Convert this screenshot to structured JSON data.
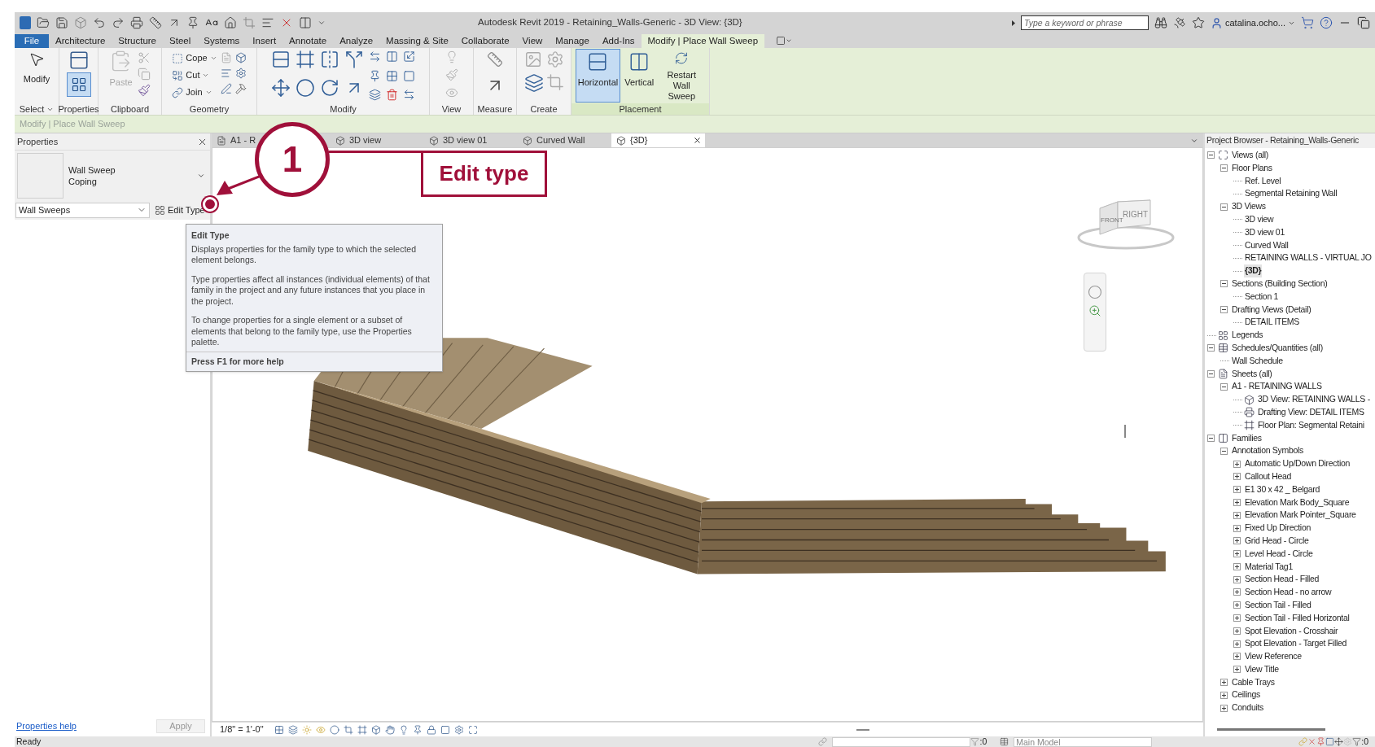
{
  "title_bar": {
    "title": "Autodesk Revit 2019 - Retaining_Walls-Generic - 3D View: {3D}",
    "search": {
      "placeholder": "Type a keyword or phrase"
    },
    "user": "catalina.ocho..."
  },
  "ribbon_tabs": [
    {
      "label": "File",
      "kind": "file",
      "selected": false
    },
    {
      "label": "Architecture",
      "kind": "tab",
      "selected": false
    },
    {
      "label": "Structure",
      "kind": "tab",
      "selected": false
    },
    {
      "label": "Steel",
      "kind": "tab",
      "selected": false
    },
    {
      "label": "Systems",
      "kind": "tab",
      "selected": false
    },
    {
      "label": "Insert",
      "kind": "tab",
      "selected": false
    },
    {
      "label": "Annotate",
      "kind": "tab",
      "selected": false
    },
    {
      "label": "Analyze",
      "kind": "tab",
      "selected": false
    },
    {
      "label": "Massing & Site",
      "kind": "tab",
      "selected": false
    },
    {
      "label": "Collaborate",
      "kind": "tab",
      "selected": false
    },
    {
      "label": "View",
      "kind": "tab",
      "selected": false
    },
    {
      "label": "Manage",
      "kind": "tab",
      "selected": false
    },
    {
      "label": "Add-Ins",
      "kind": "tab",
      "selected": false
    },
    {
      "label": "Modify | Place Wall Sweep",
      "kind": "tab",
      "selected": true
    }
  ],
  "ribbon_panels": [
    {
      "label": "Select",
      "tools": [
        {
          "label": "Modify"
        }
      ]
    },
    {
      "label": "Properties"
    },
    {
      "label": "Clipboard",
      "tools": [
        {
          "label": "Paste",
          "disabled": true
        }
      ]
    },
    {
      "label": "Geometry",
      "tools": [
        {
          "label": "Cope"
        },
        {
          "label": "Cut"
        },
        {
          "label": "Join"
        }
      ]
    },
    {
      "label": "Modify"
    },
    {
      "label": "View"
    },
    {
      "label": "Measure"
    },
    {
      "label": "Create"
    },
    {
      "label": "Placement",
      "tools": [
        {
          "label": "Horizontal",
          "selected": true
        },
        {
          "label": "Vertical",
          "selected": false
        },
        {
          "label": "Restart Wall Sweep",
          "selected": false
        }
      ]
    }
  ],
  "options_bar": {
    "text": "Modify | Place Wall Sweep"
  },
  "properties": {
    "title": "Properties",
    "type_name": "Wall Sweep",
    "type_variant": "Coping",
    "filter": "Wall Sweeps",
    "edit_type": "Edit Type",
    "help_link": "Properties help",
    "apply": "Apply"
  },
  "tooltip": {
    "title": "Edit Type",
    "paragraphs": [
      "Displays properties for the family type to which the selected element belongs.",
      "Type properties affect all instances (individual elements) of that family in the project and any future instances that you place in the project.",
      "To change properties for a single element or a subset of elements that belong to the family type, use the Properties palette."
    ],
    "footer": "Press F1 for more help"
  },
  "annotation": {
    "number": "1",
    "label": "Edit type"
  },
  "view_tabs": [
    {
      "label": "A1 - R",
      "kind": "sheet",
      "selected": false
    },
    {
      "label": "3D view",
      "kind": "view3d",
      "selected": false
    },
    {
      "label": "3D view 01",
      "kind": "view3d",
      "selected": false
    },
    {
      "label": "Curved Wall",
      "kind": "view3d",
      "selected": false
    },
    {
      "label": "{3D}",
      "kind": "view3d",
      "selected": true
    }
  ],
  "view_cube": {
    "faces": [
      "FRONT",
      "RIGHT"
    ]
  },
  "view_control_bar": {
    "scale": "1/8\" = 1'-0\""
  },
  "project_browser": {
    "title": "Project Browser - Retaining_Walls-Generic",
    "tree": [
      {
        "label": "Views (all)",
        "kind": "views",
        "selected": false,
        "expanded": true,
        "children": [
          {
            "label": "Floor Plans",
            "selected": false,
            "expanded": true,
            "children": [
              {
                "label": "Ref. Level",
                "selected": false
              },
              {
                "label": "Segmental Retaining Wall",
                "selected": false
              }
            ]
          },
          {
            "label": "3D Views",
            "selected": false,
            "expanded": true,
            "children": [
              {
                "label": "3D view",
                "selected": false
              },
              {
                "label": "3D view 01",
                "selected": false
              },
              {
                "label": "Curved Wall",
                "selected": false
              },
              {
                "label": "RETAINING WALLS - VIRTUAL JO",
                "selected": false
              },
              {
                "label": "{3D}",
                "selected": true
              }
            ]
          },
          {
            "label": "Sections (Building Section)",
            "selected": false,
            "expanded": true,
            "children": [
              {
                "label": "Section 1",
                "selected": false
              }
            ]
          },
          {
            "label": "Drafting Views (Detail)",
            "selected": false,
            "expanded": true,
            "children": [
              {
                "label": "DETAIL ITEMS",
                "selected": false
              }
            ]
          }
        ]
      },
      {
        "label": "Legends",
        "kind": "legends",
        "selected": false
      },
      {
        "label": "Schedules/Quantities (all)",
        "kind": "schedules",
        "selected": false,
        "expanded": true,
        "children": [
          {
            "label": "Wall Schedule",
            "selected": false
          }
        ]
      },
      {
        "label": "Sheets (all)",
        "kind": "sheets",
        "selected": false,
        "expanded": true,
        "children": [
          {
            "label": "A1 - RETAINING WALLS",
            "selected": false,
            "expanded": true,
            "children": [
              {
                "label": "3D View: RETAINING WALLS -",
                "kind": "view3d",
                "selected": false
              },
              {
                "label": "Drafting View: DETAIL ITEMS",
                "kind": "drafting",
                "selected": false
              },
              {
                "label": "Floor Plan: Segmental Retaini",
                "kind": "plan",
                "selected": false
              }
            ]
          }
        ]
      },
      {
        "label": "Families",
        "kind": "families",
        "selected": false,
        "expanded": true,
        "children": [
          {
            "label": "Annotation Symbols",
            "selected": false,
            "expanded": true,
            "children": [
              {
                "label": "Automatic Up/Down Direction",
                "selected": false,
                "expanded": false
              },
              {
                "label": "Callout Head",
                "selected": false,
                "expanded": false
              },
              {
                "label": "E1 30 x 42 _ Belgard",
                "selected": false,
                "expanded": false
              },
              {
                "label": "Elevation Mark Body_Square",
                "selected": false,
                "expanded": false
              },
              {
                "label": "Elevation Mark Pointer_Square",
                "selected": false,
                "expanded": false
              },
              {
                "label": "Fixed Up Direction",
                "selected": false,
                "expanded": false
              },
              {
                "label": "Grid Head - Circle",
                "selected": false,
                "expanded": false
              },
              {
                "label": "Level Head - Circle",
                "selected": false,
                "expanded": false
              },
              {
                "label": "Material Tag1",
                "selected": false,
                "expanded": false
              },
              {
                "label": "Section Head - Filled",
                "selected": false,
                "expanded": false
              },
              {
                "label": "Section Head - no arrow",
                "selected": false,
                "expanded": false
              },
              {
                "label": "Section Tail - Filled",
                "selected": false,
                "expanded": false
              },
              {
                "label": "Section Tail - Filled Horizontal",
                "selected": false,
                "expanded": false
              },
              {
                "label": "Spot Elevation - Crosshair",
                "selected": false,
                "expanded": false
              },
              {
                "label": "Spot Elevation - Target Filled",
                "selected": false,
                "expanded": false
              },
              {
                "label": "View Reference",
                "selected": false,
                "expanded": false
              },
              {
                "label": "View Title",
                "selected": false,
                "expanded": false
              }
            ]
          },
          {
            "label": "Cable Trays",
            "selected": false,
            "expanded": false
          },
          {
            "label": "Ceilings",
            "selected": false,
            "expanded": false
          },
          {
            "label": "Conduits",
            "selected": false,
            "expanded": false
          }
        ]
      }
    ]
  },
  "status_bar": {
    "text": "Ready",
    "link_count": ":0",
    "workset": "Main Model",
    "filter_count": ":0"
  }
}
